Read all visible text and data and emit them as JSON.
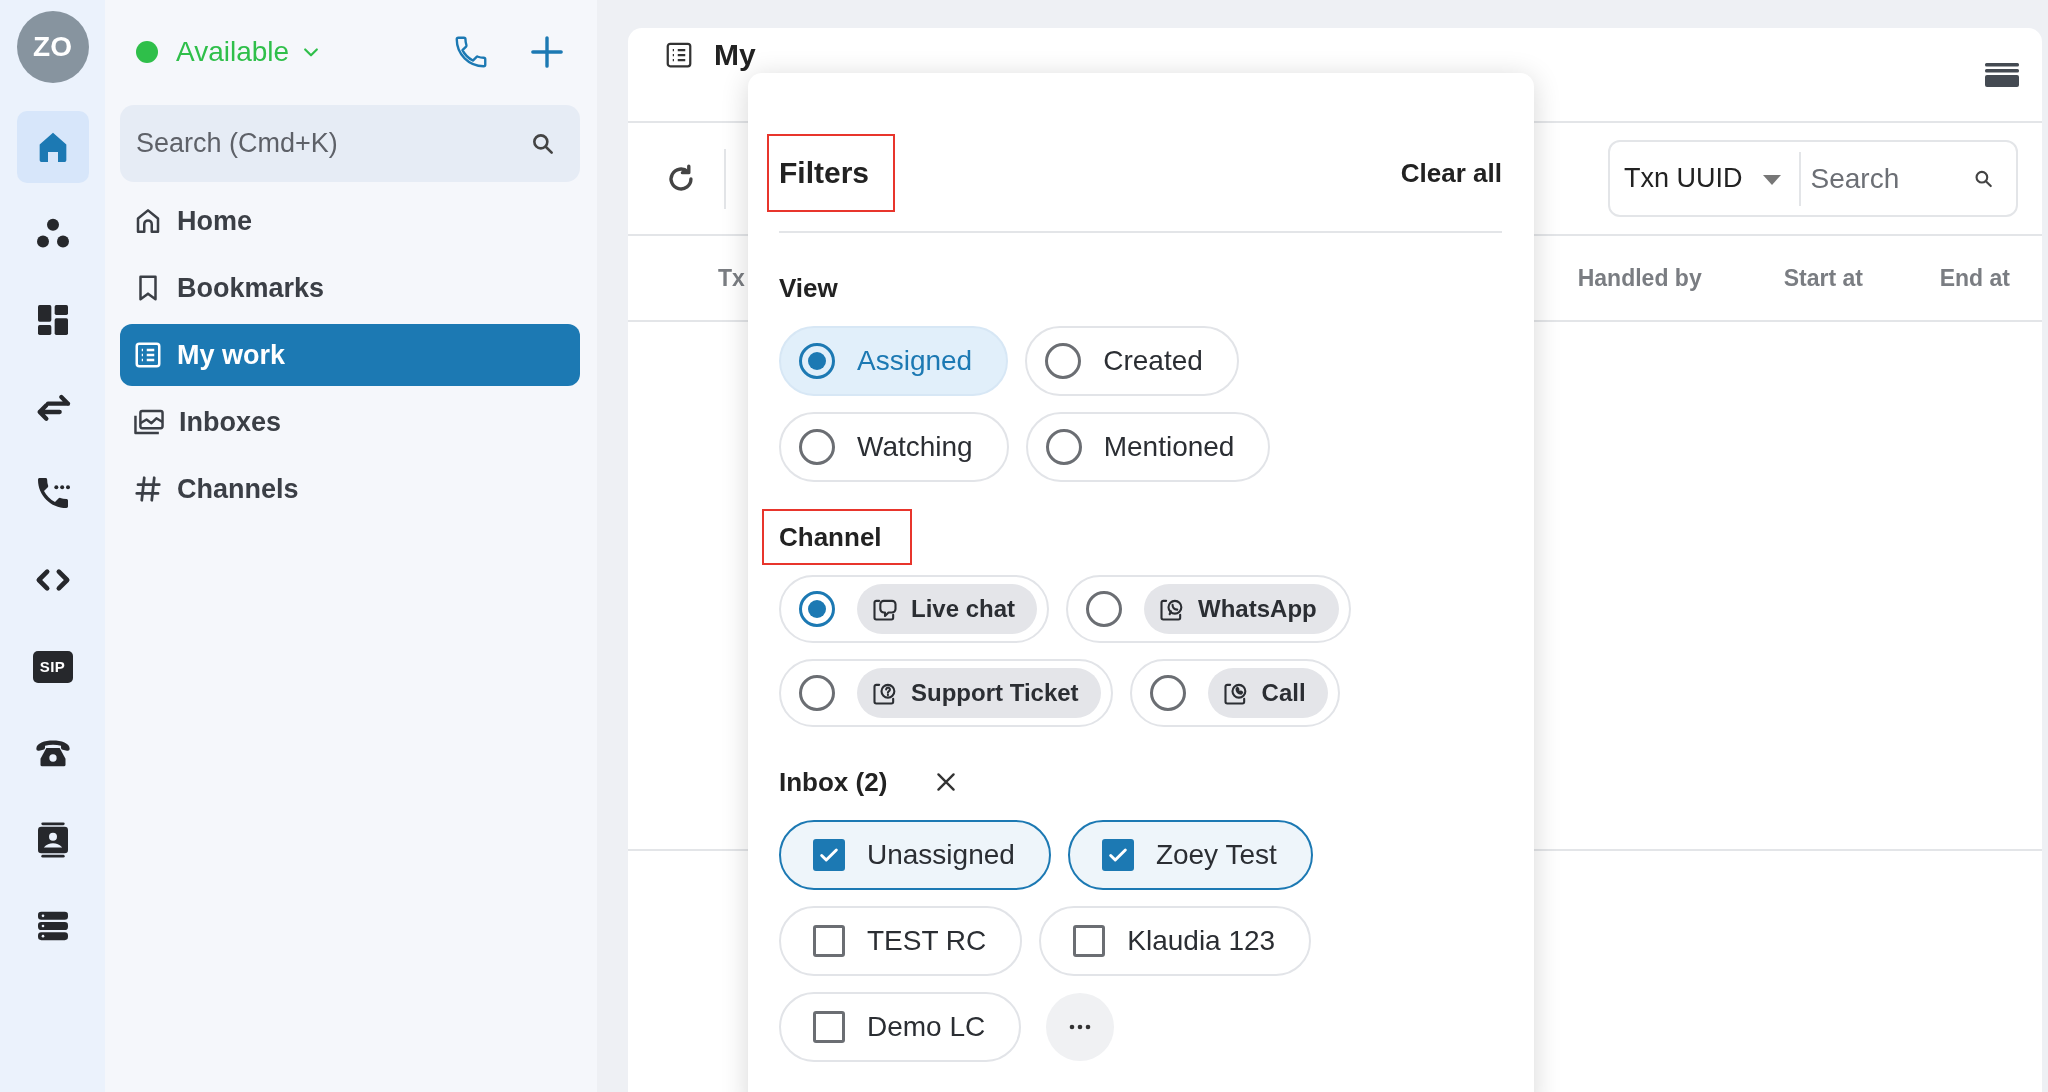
{
  "rail": {
    "avatar": "ZO",
    "items": [
      {
        "kind": "home",
        "selected": true
      },
      {
        "kind": "groups",
        "selected": false
      },
      {
        "kind": "dashboard",
        "selected": false
      },
      {
        "kind": "transfer",
        "selected": false
      },
      {
        "kind": "phone-dots",
        "selected": false
      },
      {
        "kind": "code",
        "selected": false
      },
      {
        "kind": "sip",
        "label": "SIP",
        "selected": false
      },
      {
        "kind": "telephone",
        "selected": false
      },
      {
        "kind": "contact",
        "selected": false
      },
      {
        "kind": "server",
        "selected": false
      }
    ]
  },
  "sidebar": {
    "status": "Available",
    "search": {
      "placeholder": "Search (Cmd+K)"
    },
    "nav": [
      {
        "label": "Home",
        "kind": "home",
        "selected": false
      },
      {
        "label": "Bookmarks",
        "kind": "bookmark",
        "selected": false
      },
      {
        "label": "My work",
        "kind": "list",
        "selected": true
      },
      {
        "label": "Inboxes",
        "kind": "inbox",
        "selected": false
      },
      {
        "label": "Channels",
        "kind": "hash",
        "selected": false
      }
    ]
  },
  "main": {
    "title": "My",
    "toolbar": {
      "search_by": "Txn UUID",
      "search": {
        "placeholder": "Search"
      }
    },
    "table": {
      "columns": [
        "Tx",
        "Handled by",
        "Start at",
        "End at"
      ]
    }
  },
  "filters": {
    "title": {
      "text": "Filters",
      "highlighted": true
    },
    "clear": "Clear all",
    "sections": [
      {
        "kind": "radio",
        "title": "View",
        "highlighted": false,
        "options": [
          {
            "label": "Assigned",
            "selected": true
          },
          {
            "label": "Created",
            "selected": false
          },
          {
            "label": "Watching",
            "selected": false
          },
          {
            "label": "Mentioned",
            "selected": false
          }
        ]
      },
      {
        "kind": "channel",
        "title": "Channel",
        "highlighted": true,
        "options": [
          {
            "label": "Live chat",
            "kind": "chat",
            "selected": true
          },
          {
            "label": "WhatsApp",
            "kind": "whatsapp",
            "selected": false
          },
          {
            "label": "Support Ticket",
            "kind": "ticket",
            "selected": false
          },
          {
            "label": "Call",
            "kind": "call",
            "selected": false
          }
        ]
      },
      {
        "kind": "checkbox",
        "title": "Inbox (2)",
        "highlighted": false,
        "clearable": true,
        "more": true,
        "options": [
          {
            "label": "Unassigned",
            "checked": true
          },
          {
            "label": "Zoey Test",
            "checked": true
          },
          {
            "label": "TEST RC",
            "checked": false
          },
          {
            "label": "Klaudia 123",
            "checked": false
          },
          {
            "label": "Demo LC",
            "checked": false
          }
        ]
      }
    ]
  }
}
